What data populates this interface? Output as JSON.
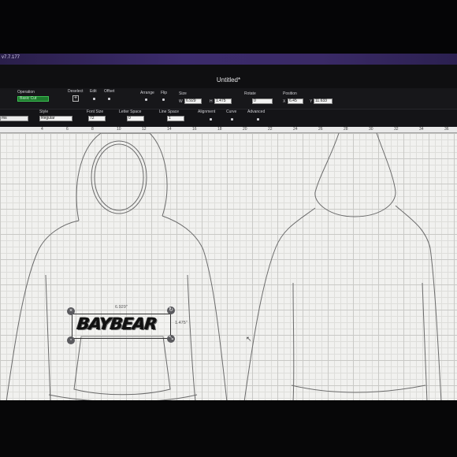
{
  "app": {
    "version": "v7.7.177",
    "document_title": "Untitled*"
  },
  "toolbar": {
    "operation": {
      "label": "Operation",
      "value": "Basic Cut"
    },
    "deselect_label": "Deselect",
    "edit_label": "Edit",
    "offset_label": "Offset",
    "arrange_label": "Arrange",
    "flip_label": "Flip",
    "size": {
      "label": "Size",
      "w_label": "W",
      "w_value": "6.929",
      "h_label": "H",
      "h_value": "1.475"
    },
    "rotate": {
      "label": "Rotate",
      "value": "0"
    },
    "position": {
      "label": "Position",
      "x_label": "X",
      "x_value": "6.45",
      "y_label": "Y",
      "y_value": "11.633"
    }
  },
  "text_toolbar": {
    "font_partial": "ms",
    "style": {
      "label": "Style",
      "value": "Regular"
    },
    "font_size": {
      "label": "Font Size",
      "value": "72"
    },
    "letter_space": {
      "label": "Letter Space",
      "value": "0"
    },
    "line_space": {
      "label": "Line Space",
      "value": "1"
    },
    "alignment_label": "Alignment",
    "curve_label": "Curve",
    "advanced_label": "Advanced"
  },
  "ruler": {
    "ticks": [
      "4",
      "6",
      "8",
      "10",
      "12",
      "14",
      "16",
      "18",
      "20",
      "22",
      "24",
      "26",
      "28",
      "30",
      "32",
      "34",
      "36"
    ]
  },
  "canvas": {
    "selected_text": "BAYBEAR",
    "width_dimension": "6.929\"",
    "height_dimension": "1.475\""
  },
  "colors": {
    "accent_green": "#1e7a2e",
    "title_bar": "#3b2b6b",
    "canvas_bg": "#f1f1ef"
  },
  "icons": [
    "close-icon",
    "rotate-icon",
    "lock-icon",
    "resize-icon",
    "plus-icon"
  ]
}
